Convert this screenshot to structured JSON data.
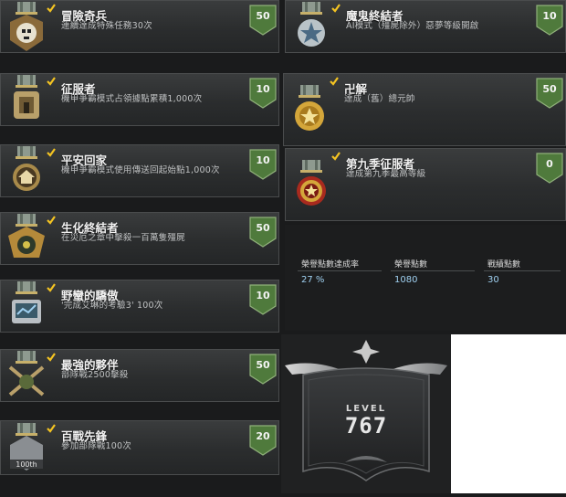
{
  "achievements_left": [
    {
      "title": "冒險奇兵",
      "desc": "連續達成特殊任務30次",
      "points": "50",
      "icon": "skull-medal-icon"
    },
    {
      "title": "征服者",
      "desc": "機甲爭霸模式占領據點累積1,000次",
      "points": "10",
      "icon": "fortress-medal-icon"
    },
    {
      "title": "平安回家",
      "desc": "機甲爭霸模式使用傳送回起始點1,000次",
      "points": "10",
      "icon": "home-medal-icon"
    },
    {
      "title": "生化終結者",
      "desc": "在災厄之章中擊殺一百萬隻殭屍",
      "points": "50",
      "icon": "biohazard-medal-icon"
    },
    {
      "title": "野蠻的驕傲",
      "desc": "'完成艾琳的考驗3' 100次",
      "points": "10",
      "icon": "monitor-medal-icon"
    },
    {
      "title": "最強的夥伴",
      "desc": "部隊戰2500擊殺",
      "points": "50",
      "icon": "crossed-rifles-medal-icon"
    },
    {
      "title": "百戰先鋒",
      "desc": "參加部隊戰100次",
      "points": "20",
      "icon": "100th-medal-icon"
    }
  ],
  "achievements_right": [
    {
      "title": "魔鬼終結者",
      "desc": "AI模式（殭屍除外）惡夢等級開啟",
      "points": "10",
      "icon": "star-medal-icon"
    },
    {
      "title": "卍解",
      "desc": "達成（舊）總元帥",
      "points": "50",
      "icon": "marshal-medal-icon"
    },
    {
      "title": "第九季征服者",
      "desc": "達成第九季最高等級",
      "points": "0",
      "icon": "season-conqueror-medal-icon"
    }
  ],
  "stats": {
    "completion_label": "榮譽點數達成率",
    "completion_value": "27 %",
    "honor_label": "榮譽點數",
    "honor_value": "1080",
    "battle_label": "戰績點數",
    "battle_value": "30"
  },
  "level": {
    "label": "LEVEL",
    "value": "767"
  },
  "colors": {
    "badge_green": "#4f7a3c",
    "check_yellow": "#f3c322",
    "stat_blue": "#9fd0f0"
  }
}
